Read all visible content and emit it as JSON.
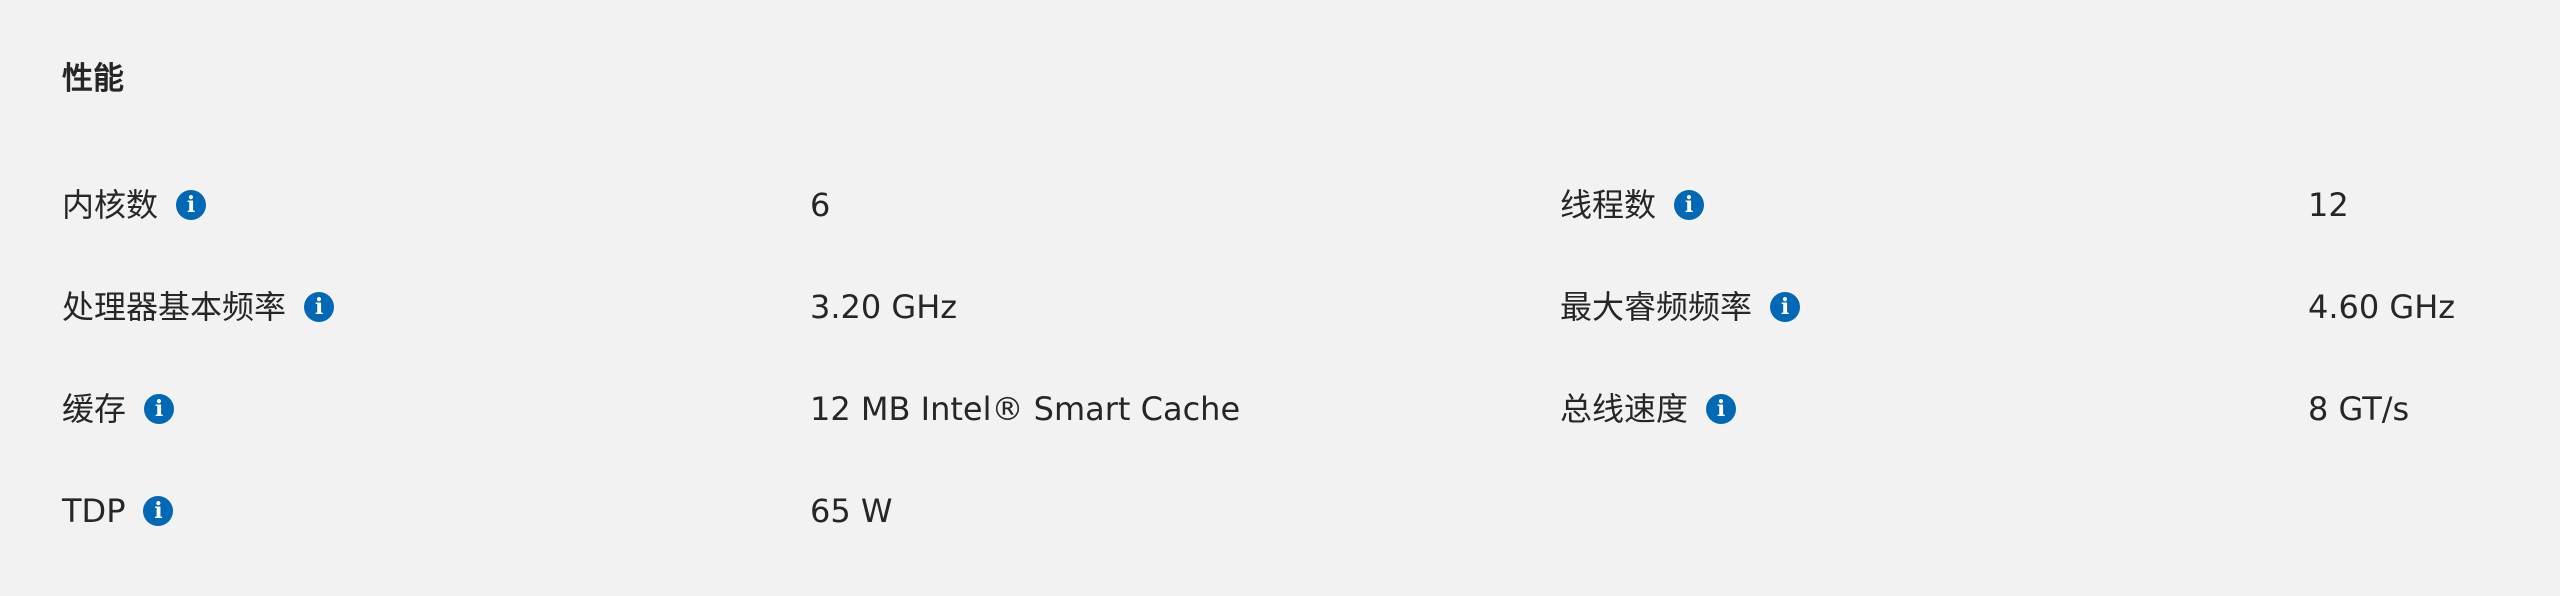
{
  "section": {
    "title": "性能"
  },
  "info_icon_glyph": "i",
  "specs": [
    {
      "label": "内核数",
      "value": "6"
    },
    {
      "label": "线程数",
      "value": "12"
    },
    {
      "label": "处理器基本频率",
      "value": "3.20 GHz"
    },
    {
      "label": "最大睿频频率",
      "value": "4.60 GHz"
    },
    {
      "label": "缓存",
      "value": "12 MB Intel® Smart Cache"
    },
    {
      "label": "总线速度",
      "value": "8 GT/s"
    },
    {
      "label": "TDP",
      "value": "65 W"
    }
  ],
  "colors": {
    "background": "#f2f2f2",
    "text": "#262626",
    "info_icon": "#0068b5"
  }
}
